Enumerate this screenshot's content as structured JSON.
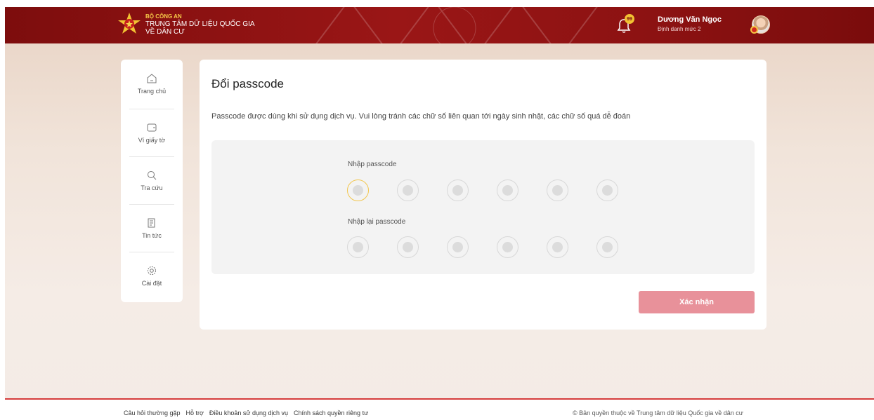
{
  "header": {
    "org_top": "BỘ CÔNG AN",
    "org_mid": "TRUNG TÂM DỮ LIỆU QUỐC GIA",
    "org_bot": "VỀ DÂN CƯ",
    "bell_badge": "99",
    "user_name": "Dương Văn Ngọc",
    "user_level": "Định danh mức 2",
    "brand_color": "#8c1212",
    "accent_color": "#f2c232"
  },
  "sidebar": {
    "items": [
      {
        "label": "Trang chủ",
        "icon": "home-icon"
      },
      {
        "label": "Ví giấy tờ",
        "icon": "wallet-icon"
      },
      {
        "label": "Tra cứu",
        "icon": "search-icon"
      },
      {
        "label": "Tin tức",
        "icon": "news-icon"
      },
      {
        "label": "Cài đặt",
        "icon": "gear-icon"
      }
    ]
  },
  "main": {
    "title": "Đổi passcode",
    "description": "Passcode được dùng khi sử dụng dịch vụ. Vui lòng tránh các chữ số liên quan tới ngày sinh nhật, các chữ số quá dễ đoán",
    "passcode_label": "Nhập passcode",
    "repeat_label": "Nhập lại passcode",
    "digits_count": 6,
    "confirm_label": "Xác nhận",
    "confirm_color": "#e8919a"
  },
  "footer": {
    "links": [
      "Câu hỏi thường gặp",
      "Hỗ trợ",
      "Điều khoản sử dụng dịch vụ",
      "Chính sách quyền riêng tư"
    ],
    "copyright": "© Bản quyền thuộc về Trung tâm dữ liệu Quốc gia về dân cư"
  }
}
